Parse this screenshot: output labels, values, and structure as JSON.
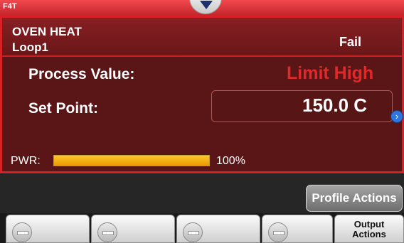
{
  "topbar": {
    "brand": "F4T"
  },
  "loop": {
    "title": "OVEN HEAT",
    "subtitle": "Loop1",
    "status": "Fail",
    "process_value_label": "Process Value:",
    "process_value": "Limit High",
    "set_point_label": "Set Point:",
    "set_point": "150.0 C"
  },
  "power": {
    "label": "PWR:",
    "percent_text": "100%",
    "level_fraction": 1.0
  },
  "buttons": {
    "profile_actions": "Profile Actions",
    "output_actions_line1": "Output",
    "output_actions_line2": "Actions"
  },
  "colors": {
    "panel_bg": "#5a1617",
    "accent_red": "#d62126",
    "alarm_text": "#e02a2a",
    "power_bar": "#f5b01a"
  },
  "icons": {
    "topbar_tab": "chevron-down-icon",
    "setpoint_arrow": "chevron-right-icon",
    "softkeys": "minus-icon"
  }
}
